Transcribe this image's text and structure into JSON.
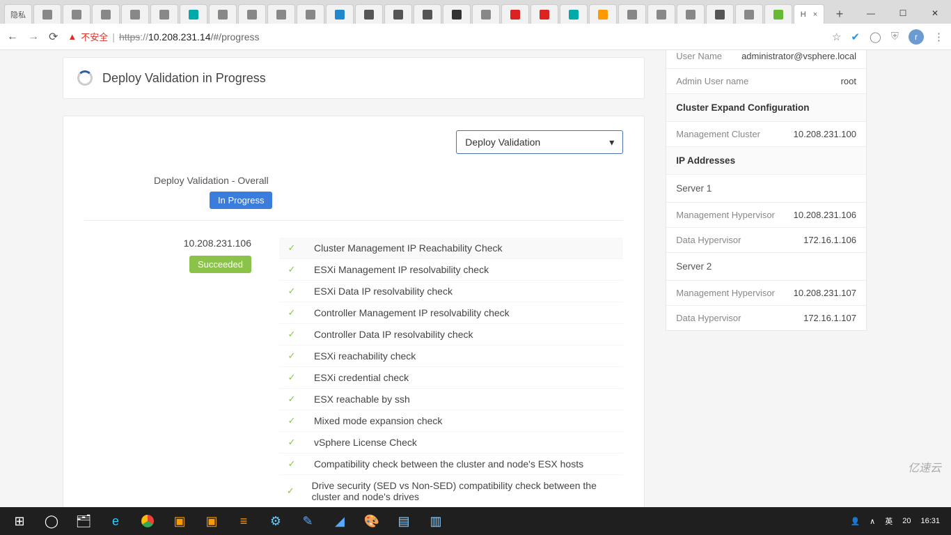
{
  "browser": {
    "insecure_label": "不安全",
    "url_proto": "https",
    "url_host": "10.208.231.14",
    "url_path": "/#/progress",
    "active_tab_label": "H",
    "new_tab_glyph": "+",
    "avatar_letter": "r"
  },
  "win": {
    "min": "—",
    "max": "☐",
    "close": "✕"
  },
  "header": {
    "title": "Deploy Validation in Progress"
  },
  "select": {
    "label": "Deploy Validation",
    "caret": "▾"
  },
  "overall": {
    "label": "Deploy Validation - Overall",
    "status": "In Progress"
  },
  "server": {
    "ip": "10.208.231.106",
    "status": "Succeeded",
    "checks": [
      "Cluster Management IP Reachability Check",
      "ESXi Management IP resolvability check",
      "ESXi Data IP resolvability check",
      "Controller Management IP resolvability check",
      "Controller Data IP resolvability check",
      "ESXi reachability check",
      "ESXi credential check",
      "ESX reachable by ssh",
      "Mixed mode expansion check",
      "vSphere License Check",
      "Compatibility check between the cluster and node's ESX hosts",
      "Drive security (SED vs Non-SED) compatibility check between the cluster and node's drives"
    ]
  },
  "side": {
    "user_name_k": "User Name",
    "user_name_v": "administrator@vsphere.local",
    "admin_k": "Admin User name",
    "admin_v": "root",
    "sect_cluster": "Cluster Expand Configuration",
    "mgmt_cluster_k": "Management Cluster",
    "mgmt_cluster_v": "10.208.231.100",
    "sect_ip": "IP Addresses",
    "server1": "Server 1",
    "s1_mh_k": "Management Hypervisor",
    "s1_mh_v": "10.208.231.106",
    "s1_dh_k": "Data Hypervisor",
    "s1_dh_v": "172.16.1.106",
    "server2": "Server 2",
    "s2_mh_k": "Management Hypervisor",
    "s2_mh_v": "10.208.231.107",
    "s2_dh_k": "Data Hypervisor",
    "s2_dh_v": "172.16.1.107"
  },
  "taskbar": {
    "time": "16:31",
    "date_small": "20",
    "ime": "英",
    "caret": "∧",
    "people": "⛉"
  },
  "watermark": "亿速云"
}
